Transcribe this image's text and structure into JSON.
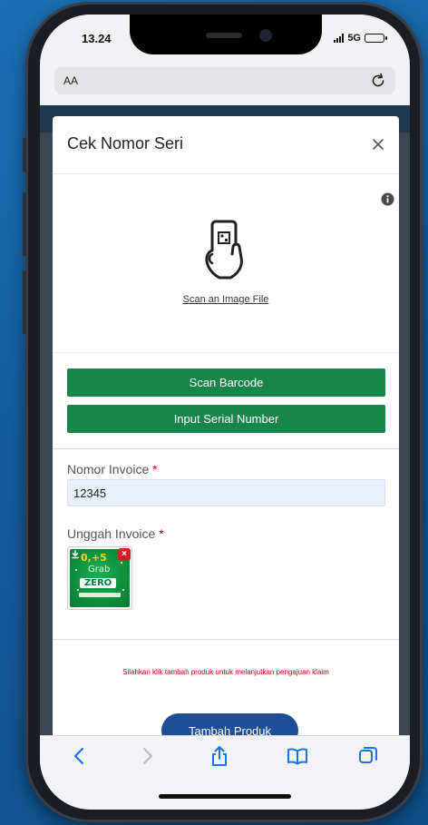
{
  "status_bar": {
    "time": "13.24",
    "network": "5G"
  },
  "browser": {
    "address_text": "AA"
  },
  "modal": {
    "title": "Cek Nomor Seri",
    "scan_image_link": "Scan an Image File",
    "scan_barcode_label": "Scan Barcode",
    "input_serial_label": "Input Serial Number",
    "invoice_label": "Nomor Invoice",
    "required_mark": "*",
    "invoice_value": "12345",
    "upload_label": "Unggah Invoice",
    "thumbnail": {
      "line1_left": "0,",
      "line1_mid": "+",
      "line1_right": "5",
      "line2": "Grab",
      "line3": "ZERO",
      "delete_glyph": "×"
    },
    "warning": "Silahkan klik tambah produk untuk melanjutkan pengajuan klaim",
    "add_product_label": "Tambah Produk"
  },
  "colors": {
    "green_button": "#18864b",
    "blue_button": "#1f4e94",
    "required": "#d0021b",
    "ios_blue": "#1a73e8"
  },
  "icons": {
    "close": "close-icon",
    "info": "info-icon",
    "scan_phone": "phone-hand-icon",
    "reload": "reload-icon",
    "back": "back-icon",
    "forward": "forward-icon",
    "share": "share-icon",
    "bookmarks": "bookmarks-icon",
    "tabs": "tabs-icon"
  }
}
